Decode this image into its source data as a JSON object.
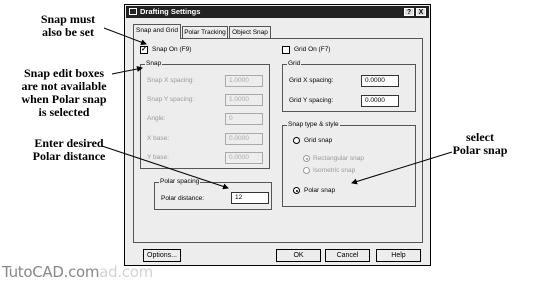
{
  "annotations": {
    "snap_must": [
      "Snap must",
      "also be set"
    ],
    "snap_edit": [
      "Snap edit boxes",
      "are not available",
      "when Polar snap",
      "is selected"
    ],
    "enter_polar": [
      "Enter desired",
      "Polar distance"
    ],
    "select_polar": [
      "select",
      "Polar snap"
    ]
  },
  "dialog": {
    "title": "Drafting Settings",
    "help_btn": "?",
    "close_btn": "X",
    "tabs": [
      "Snap and Grid",
      "Polar Tracking",
      "Object Snap"
    ],
    "snap_on_label": "Snap On (F9)",
    "snap_on_checked": "✓",
    "grid_on_label": "Grid On (F7)",
    "snap_group": {
      "label": "Snap",
      "fields": [
        {
          "label": "Snap X spacing:",
          "value": "1.0000"
        },
        {
          "label": "Snap Y spacing:",
          "value": "1.0000"
        },
        {
          "label": "Angle:",
          "value": "0"
        },
        {
          "label": "X base:",
          "value": "0.0000"
        },
        {
          "label": "Y base:",
          "value": "0.0000"
        }
      ]
    },
    "polar_group": {
      "label": "Polar spacing",
      "distance_label": "Polar distance:",
      "distance_value": "12"
    },
    "grid_group": {
      "label": "Grid",
      "x_label": "Grid X spacing:",
      "x_value": "0.0000",
      "y_label": "Grid Y spacing:",
      "y_value": "0.0000"
    },
    "snap_type_group": {
      "label": "Snap type & style",
      "grid_snap": "Grid snap",
      "rectangular": "Rectangular snap",
      "isometric": "Isometric snap",
      "polar_snap": "Polar snap"
    },
    "buttons": {
      "options": "Options...",
      "ok": "OK",
      "cancel": "Cancel",
      "help": "Help"
    }
  },
  "watermark": {
    "main": "TutoCAD.com",
    "ghost": "ad.com"
  }
}
